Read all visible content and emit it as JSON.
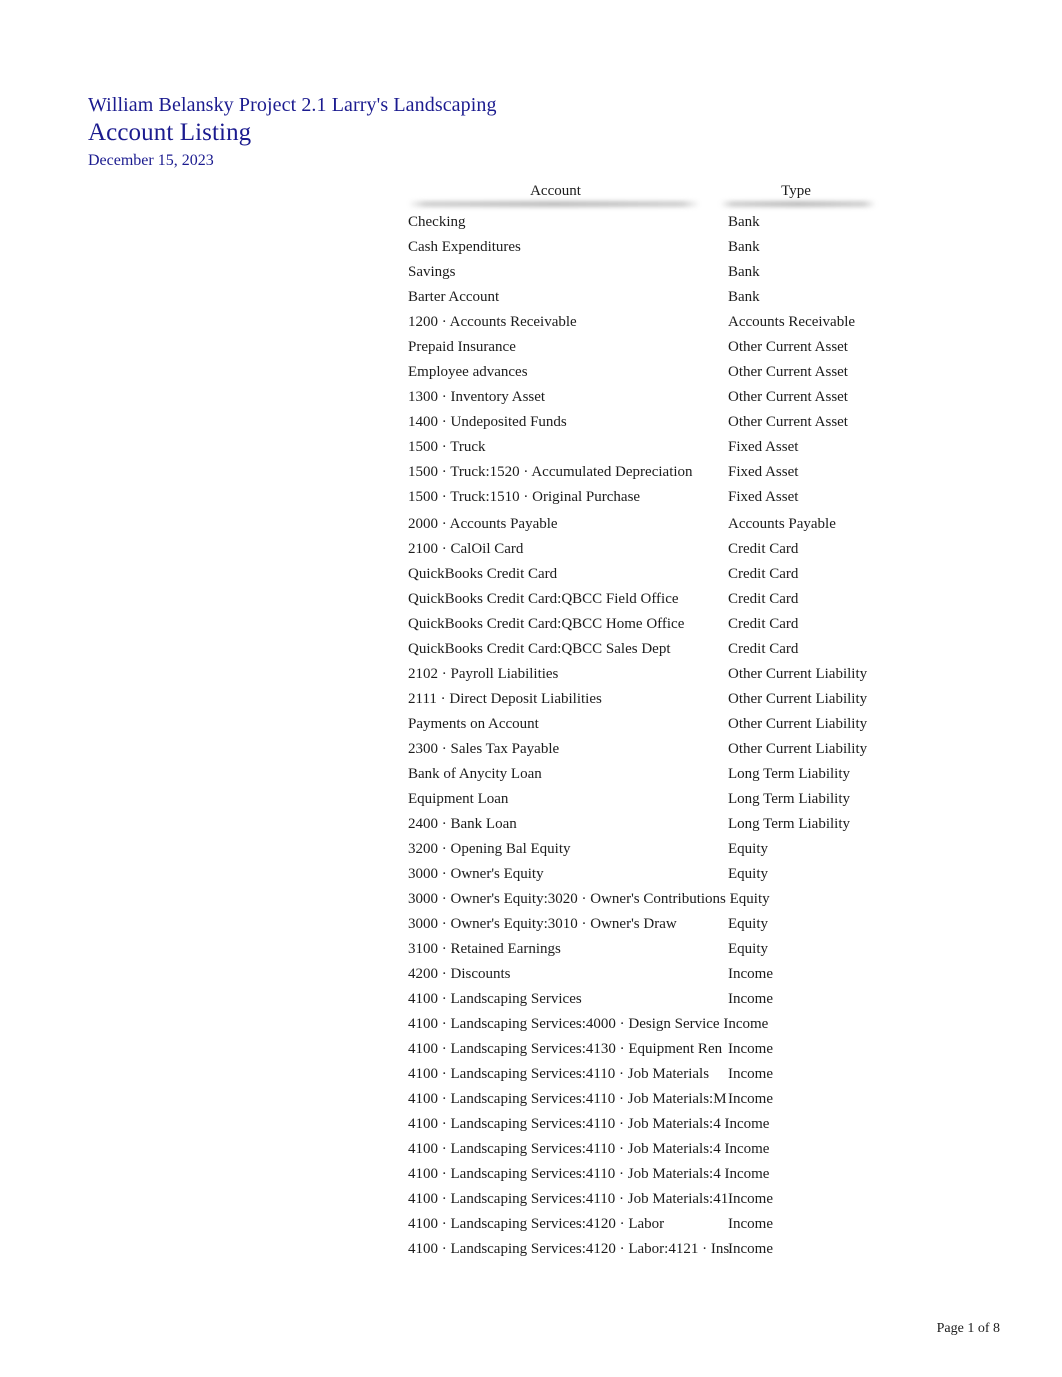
{
  "document": {
    "company_line": "William Belansky Project 2.1 Larry's Landscaping",
    "title": "Account Listing",
    "date": "December 15, 2023",
    "header_color": "#1b1b8f",
    "text_color": "#1c1c1c",
    "background": "#ffffff"
  },
  "table": {
    "columns": [
      {
        "key": "account",
        "label": "Account"
      },
      {
        "key": "type",
        "label": "Type"
      }
    ],
    "rows": [
      {
        "account": "Checking",
        "type": "Bank"
      },
      {
        "account": "Cash Expenditures",
        "type": "Bank"
      },
      {
        "account": "Savings",
        "type": "Bank"
      },
      {
        "account": "Barter Account",
        "type": "Bank"
      },
      {
        "account": "1200 · Accounts Receivable",
        "type": "Accounts Receivable"
      },
      {
        "account": "Prepaid Insurance",
        "type": "Other Current Asset"
      },
      {
        "account": "Employee advances",
        "type": "Other Current Asset"
      },
      {
        "account": "1300 · Inventory Asset",
        "type": "Other Current Asset"
      },
      {
        "account": "1400 · Undeposited Funds",
        "type": "Other Current Asset"
      },
      {
        "account": "1500 · Truck",
        "type": "Fixed Asset"
      },
      {
        "account": "1500 · Truck:1520 · Accumulated Depreciation",
        "type": "Fixed Asset"
      },
      {
        "account": "1500 · Truck:1510 · Original Purchase",
        "type": "Fixed Asset"
      },
      {
        "account": "2000 · Accounts Payable",
        "type": "Accounts Payable",
        "gap_before": true
      },
      {
        "account": "2100 · CalOil Card",
        "type": "Credit Card"
      },
      {
        "account": "QuickBooks Credit Card",
        "type": "Credit Card"
      },
      {
        "account": "QuickBooks Credit Card:QBCC Field Office",
        "type": "Credit Card"
      },
      {
        "account": "QuickBooks Credit Card:QBCC Home Office",
        "type": "Credit Card"
      },
      {
        "account": "QuickBooks Credit Card:QBCC Sales Dept",
        "type": "Credit Card"
      },
      {
        "account": "2102 · Payroll Liabilities",
        "type": "Other Current Liability"
      },
      {
        "account": "2111 · Direct Deposit Liabilities",
        "type": "Other Current Liability"
      },
      {
        "account": "Payments on Account",
        "type": "Other Current Liability"
      },
      {
        "account": "2300 · Sales Tax Payable",
        "type": "Other Current Liability"
      },
      {
        "account": "Bank of Anycity Loan",
        "type": "Long Term Liability"
      },
      {
        "account": "Equipment Loan",
        "type": "Long Term Liability"
      },
      {
        "account": "2400 · Bank Loan",
        "type": "Long Term Liability"
      },
      {
        "account": "3200 · Opening Bal Equity",
        "type": "Equity"
      },
      {
        "account": "3000 · Owner's Equity",
        "type": "Equity"
      },
      {
        "account": "3000 · Owner's Equity:3020 · Owner's Contributions Equity",
        "type": ""
      },
      {
        "account": "3000 · Owner's Equity:3010 · Owner's Draw",
        "type": "Equity"
      },
      {
        "account": "3100 · Retained Earnings",
        "type": "Equity"
      },
      {
        "account": "4200 · Discounts",
        "type": "Income"
      },
      {
        "account": "4100 · Landscaping Services",
        "type": "Income"
      },
      {
        "account": "4100 · Landscaping Services:4000 · Design Service Income",
        "type": ""
      },
      {
        "account": "4100 · Landscaping Services:4130 · Equipment Ren",
        "type": "Income"
      },
      {
        "account": "4100 · Landscaping Services:4110 · Job Materials",
        "type": "Income"
      },
      {
        "account": "4100 · Landscaping Services:4110 · Job Materials:M",
        "type": "Income"
      },
      {
        "account": "4100 · Landscaping Services:4110 · Job Materials:4 Income",
        "type": ""
      },
      {
        "account": "4100 · Landscaping Services:4110 · Job Materials:4 Income",
        "type": ""
      },
      {
        "account": "4100 · Landscaping Services:4110 · Job Materials:4 Income",
        "type": ""
      },
      {
        "account": "4100 · Landscaping Services:4110 · Job Materials:41",
        "type": "Income"
      },
      {
        "account": "4100 · Landscaping Services:4120 · Labor",
        "type": "Income"
      },
      {
        "account": "4100 · Landscaping Services:4120 · Labor:4121 · Ins",
        "type": "Income"
      }
    ]
  },
  "footer": {
    "page_label": "Page 1 of 8"
  }
}
